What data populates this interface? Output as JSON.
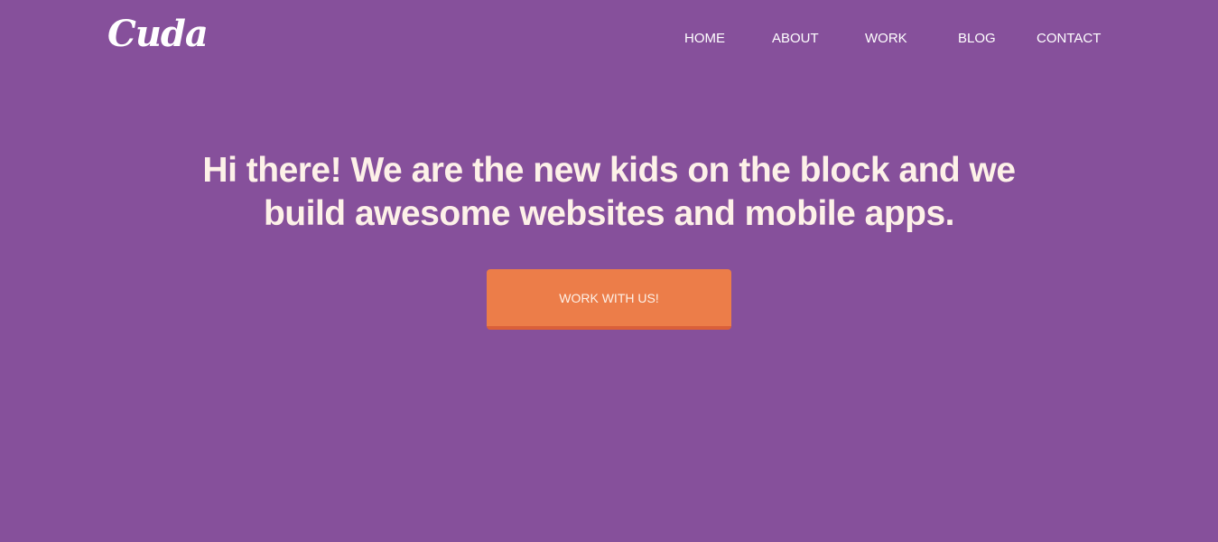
{
  "brand": {
    "logo_text": "Cuda"
  },
  "nav": {
    "items": [
      {
        "label": "HOME"
      },
      {
        "label": "ABOUT"
      },
      {
        "label": "WORK"
      },
      {
        "label": "BLOG"
      },
      {
        "label": "CONTACT"
      }
    ]
  },
  "hero": {
    "title": "Hi there! We are the new kids on the block and we build awesome websites and mobile apps.",
    "cta_label": "WORK WITH US!"
  },
  "colors": {
    "background": "#86509B",
    "cta": "#EC7D49",
    "cta_shadow": "#DA5F3A",
    "heading_text": "#FDF1E8"
  }
}
